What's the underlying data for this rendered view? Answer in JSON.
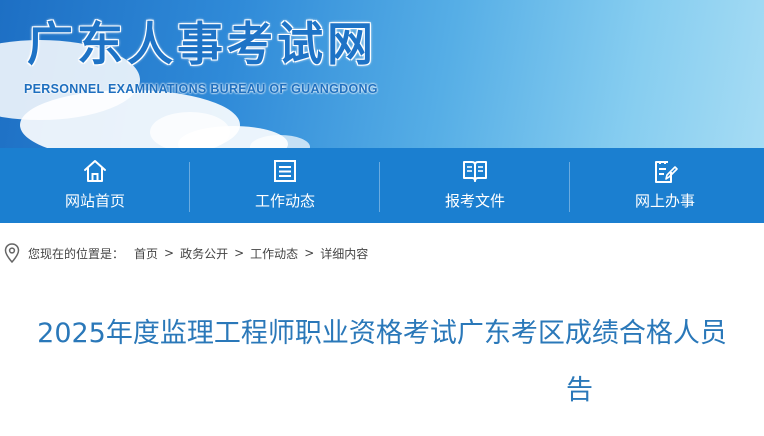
{
  "header": {
    "site_title": "广东人事考试网",
    "site_subtitle": "PERSONNEL EXAMINATIONS BUREAU OF GUANGDONG"
  },
  "nav": {
    "items": [
      {
        "label": "网站首页",
        "icon": "home-icon"
      },
      {
        "label": "工作动态",
        "icon": "news-list-icon"
      },
      {
        "label": "报考文件",
        "icon": "open-book-icon"
      },
      {
        "label": "网上办事",
        "icon": "edit-document-icon"
      }
    ]
  },
  "breadcrumb": {
    "prefix": "您现在的位置是：",
    "items": [
      "首页",
      "政务公开",
      "工作动态",
      "详细内容"
    ],
    "separator": ">"
  },
  "article": {
    "title_line1": "2025年度监理工程师职业资格考试广东考区成绩合格人员",
    "title_line2": "告"
  },
  "colors": {
    "nav_bg": "#1b7fd0",
    "title": "#2a78b9",
    "brand": "#1e73c6"
  }
}
